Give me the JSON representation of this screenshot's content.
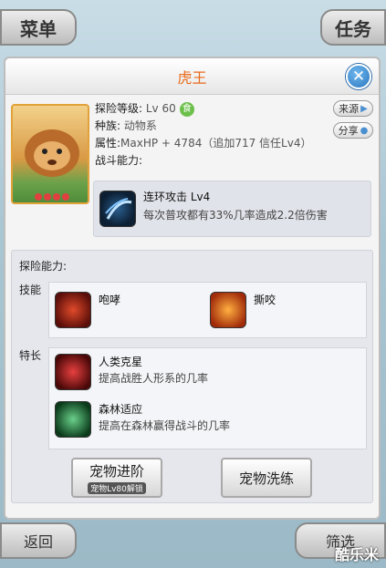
{
  "top": {
    "menu_label": "菜单",
    "task_label": "任务"
  },
  "title": "虎王",
  "info": {
    "level_key": "探险等级:",
    "level_val": "Lv 60",
    "level_badge": "食",
    "race_key": "种族:",
    "race_val": "动物系",
    "attr_key": "属性:",
    "attr_val": "MaxHP + 4784（追加717 信任Lv4）",
    "combat_key": "战斗能力:"
  },
  "side": {
    "source_label": "来源",
    "share_label": "分享"
  },
  "combat_skill": {
    "name": "连环攻击 Lv4",
    "desc": "每次普攻都有33%几率造成2.2倍伤害"
  },
  "explore": {
    "title": "探险能力:",
    "skills_label": "技能",
    "skills": [
      {
        "name": "咆哮"
      },
      {
        "name": "撕咬"
      }
    ],
    "specials_label": "特长",
    "specials": [
      {
        "name": "人类克星",
        "desc": "提高战胜人形系的几率"
      },
      {
        "name": "森林适应",
        "desc": "提高在森林赢得战斗的几率"
      }
    ]
  },
  "buttons": {
    "advance_label": "宠物进阶",
    "advance_sub": "宠物Lv80解锁",
    "train_label": "宠物洗练"
  },
  "bottom": {
    "back_label": "返回",
    "filter_label": "筛选"
  },
  "watermark": "酷乐米"
}
